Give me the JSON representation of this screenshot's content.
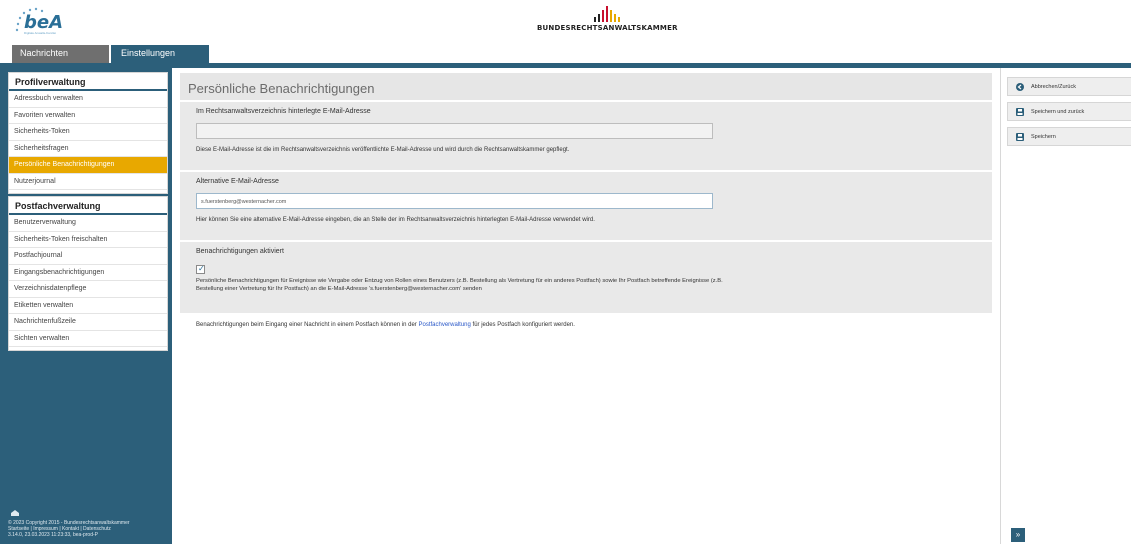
{
  "header": {
    "logo_text": "beA",
    "logo_subtitle": "Digitale Anwalts-Kanzlei",
    "brand_name": "BUNDESRECHTSANWALTSKAMMER",
    "brand_colors": [
      "#c8102e",
      "#e8a800",
      "#222222"
    ]
  },
  "tabs": [
    {
      "label": "Nachrichten"
    },
    {
      "label": "Einstellungen"
    }
  ],
  "sidebar": {
    "profil": {
      "title": "Profilverwaltung",
      "items": [
        {
          "label": "Adressbuch verwalten"
        },
        {
          "label": "Favoriten verwalten"
        },
        {
          "label": "Sicherheits-Token"
        },
        {
          "label": "Sicherheitsfragen"
        },
        {
          "label": "Persönliche Benachrichtigungen"
        },
        {
          "label": "Nutzerjournal"
        }
      ]
    },
    "postfach": {
      "title": "Postfachverwaltung",
      "items": [
        {
          "label": "Benutzerverwaltung"
        },
        {
          "label": "Sicherheits-Token freischalten"
        },
        {
          "label": "Postfachjournal"
        },
        {
          "label": "Eingangsbenachrichtigungen"
        },
        {
          "label": "Verzeichnisdatenpflege"
        },
        {
          "label": "Etiketten verwalten"
        },
        {
          "label": "Nachrichtenfußzeile"
        },
        {
          "label": "Sichten verwalten"
        }
      ]
    },
    "footer": {
      "copyright": "© 2023 Copyright 2015 - Bundesrechtsanwaltskammer",
      "links": "Startseite | Impressum | Kontakt | Datenschutz",
      "version": "3.14.0, 23.03.2023 11:23:33, bea-prod-P"
    }
  },
  "main": {
    "title": "Persönliche Benachrichtigungen",
    "registered_email": {
      "label": "Im Rechtsanwaltsverzeichnis hinterlegte E-Mail-Adresse",
      "value": "",
      "hint": "Diese E-Mail-Adresse ist die im Rechtsanwaltsverzeichnis veröffentlichte E-Mail-Adresse und wird durch die Rechtsanwaltskammer gepflegt."
    },
    "alternative_email": {
      "label": "Alternative E-Mail-Adresse",
      "value": "s.fuerstenberg@westernacher.com",
      "hint": "Hier können Sie eine alternative E-Mail-Adresse eingeben, die an Stelle der im Rechtsanwaltsverzeichnis hinterlegten E-Mail-Adresse verwendet wird."
    },
    "notifications": {
      "label": "Benachrichtigungen aktiviert",
      "checked": true,
      "text": "Persönliche Benachrichtigungen für Ereignisse wie Vergabe oder Entzug von Rollen eines Benutzers (z.B. Bestellung als Vertretung für ein anderes Postfach) sowie Ihr Postfach betreffende Ereignisse (z.B. Bestellung einer Vertretung für Ihr Postfach) an die E-Mail-Adresse 's.fuerstenberg@westernacher.com' senden"
    },
    "note_prefix": "Benachrichtigungen beim Eingang einer Nachricht in einem Postfach können in der",
    "note_link": "Postfachverwaltung",
    "note_suffix": "für jedes Postfach konfiguriert werden."
  },
  "actions": {
    "cancel": "Abbrechen/Zurück",
    "save_back": "Speichern und zurück",
    "save": "Speichern",
    "forward": "»"
  }
}
